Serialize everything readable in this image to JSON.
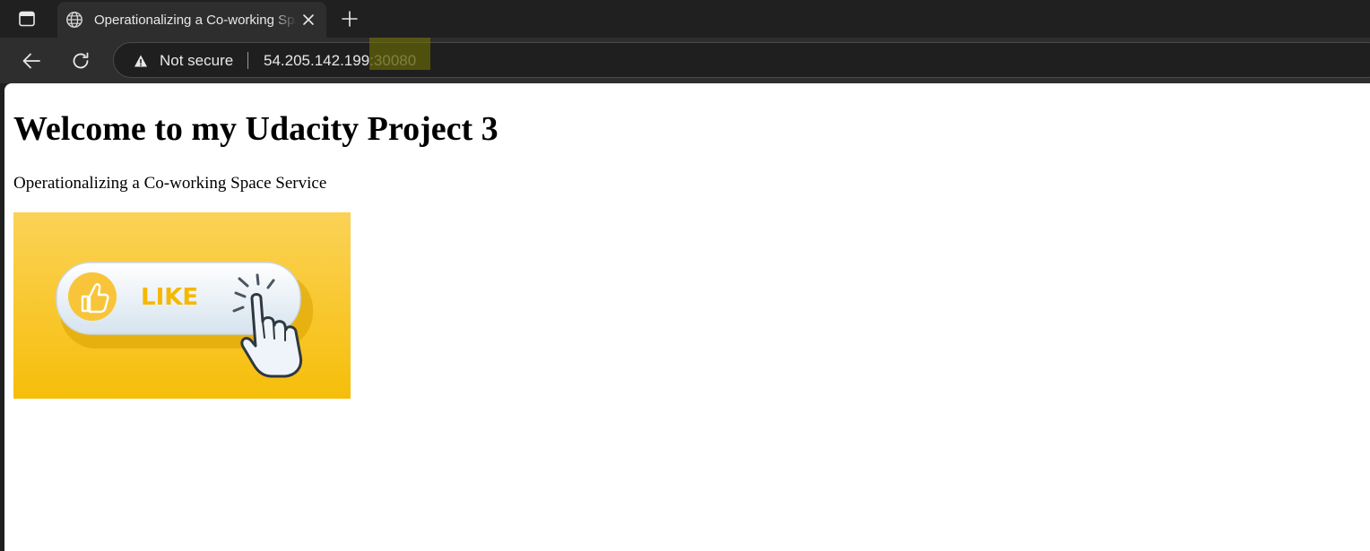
{
  "browser": {
    "tab": {
      "title": "Operationalizing a Co-working Space Service"
    },
    "address_bar": {
      "security_label": "Not secure",
      "host": "54.205.142.199",
      "colon": ":",
      "port": "30080"
    }
  },
  "page": {
    "heading": "Welcome to my Udacity Project 3",
    "paragraph": "Operationalizing a Co-working Space Service",
    "image": {
      "button_text": "LIKE"
    }
  },
  "icons": {
    "tab_actions": "tab-actions-icon",
    "favicon": "globe-icon",
    "close": "close-icon",
    "new_tab": "plus-icon",
    "back": "back-arrow-icon",
    "refresh": "refresh-icon",
    "warning": "warning-triangle-icon",
    "thumb": "thumbs-up-icon",
    "cursor": "hand-pointer-icon"
  },
  "colors": {
    "chrome_dark": "#202020",
    "toolbar": "#2e2e2e",
    "omnibox": "#1f1f1f",
    "image_yellow": "#f7c21e",
    "like_text": "#f5b800",
    "port_highlight": "#787800"
  }
}
